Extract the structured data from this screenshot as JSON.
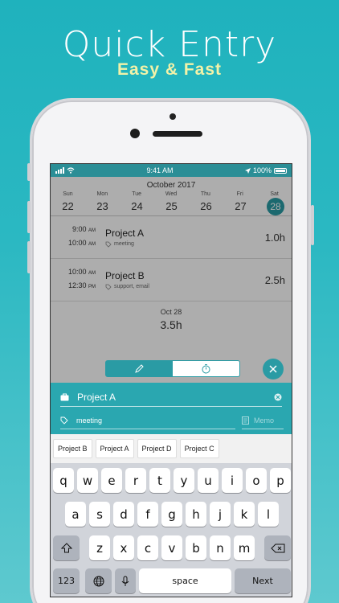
{
  "hero": {
    "title": "Quick Entry",
    "subtitle": "Easy & Fast"
  },
  "status": {
    "time": "9:41 AM",
    "battery": "100%"
  },
  "calendar": {
    "month": "October 2017",
    "weekdays": [
      "Sun",
      "Mon",
      "Tue",
      "Wed",
      "Thu",
      "Fri",
      "Sat"
    ],
    "days": [
      "22",
      "23",
      "24",
      "25",
      "26",
      "27",
      "28"
    ],
    "selected_day": "28"
  },
  "entries": [
    {
      "start": "9:00",
      "start_ampm": "AM",
      "end": "10:00",
      "end_ampm": "AM",
      "project": "Project A",
      "tags": "meeting",
      "duration": "1.0h"
    },
    {
      "start": "10:00",
      "start_ampm": "AM",
      "end": "12:30",
      "end_ampm": "PM",
      "project": "Project B",
      "tags": "support, email",
      "duration": "2.5h"
    }
  ],
  "day_summary": {
    "date": "Oct 28",
    "total": "3.5h"
  },
  "form": {
    "project": "Project A",
    "tags": "meeting",
    "memo_placeholder": "Memo"
  },
  "suggestions": [
    "Project B",
    "Project A",
    "Project D",
    "Project C"
  ],
  "keyboard": {
    "row1": [
      "q",
      "w",
      "e",
      "r",
      "t",
      "y",
      "u",
      "i",
      "o",
      "p"
    ],
    "row2": [
      "a",
      "s",
      "d",
      "f",
      "g",
      "h",
      "j",
      "k",
      "l"
    ],
    "row3": [
      "z",
      "x",
      "c",
      "v",
      "b",
      "n",
      "m"
    ],
    "numbers": "123",
    "space": "space",
    "next": "Next"
  },
  "colors": {
    "accent": "#2a9ba4",
    "background": "#1fb2bd",
    "subtitle": "#f2f2a8"
  }
}
